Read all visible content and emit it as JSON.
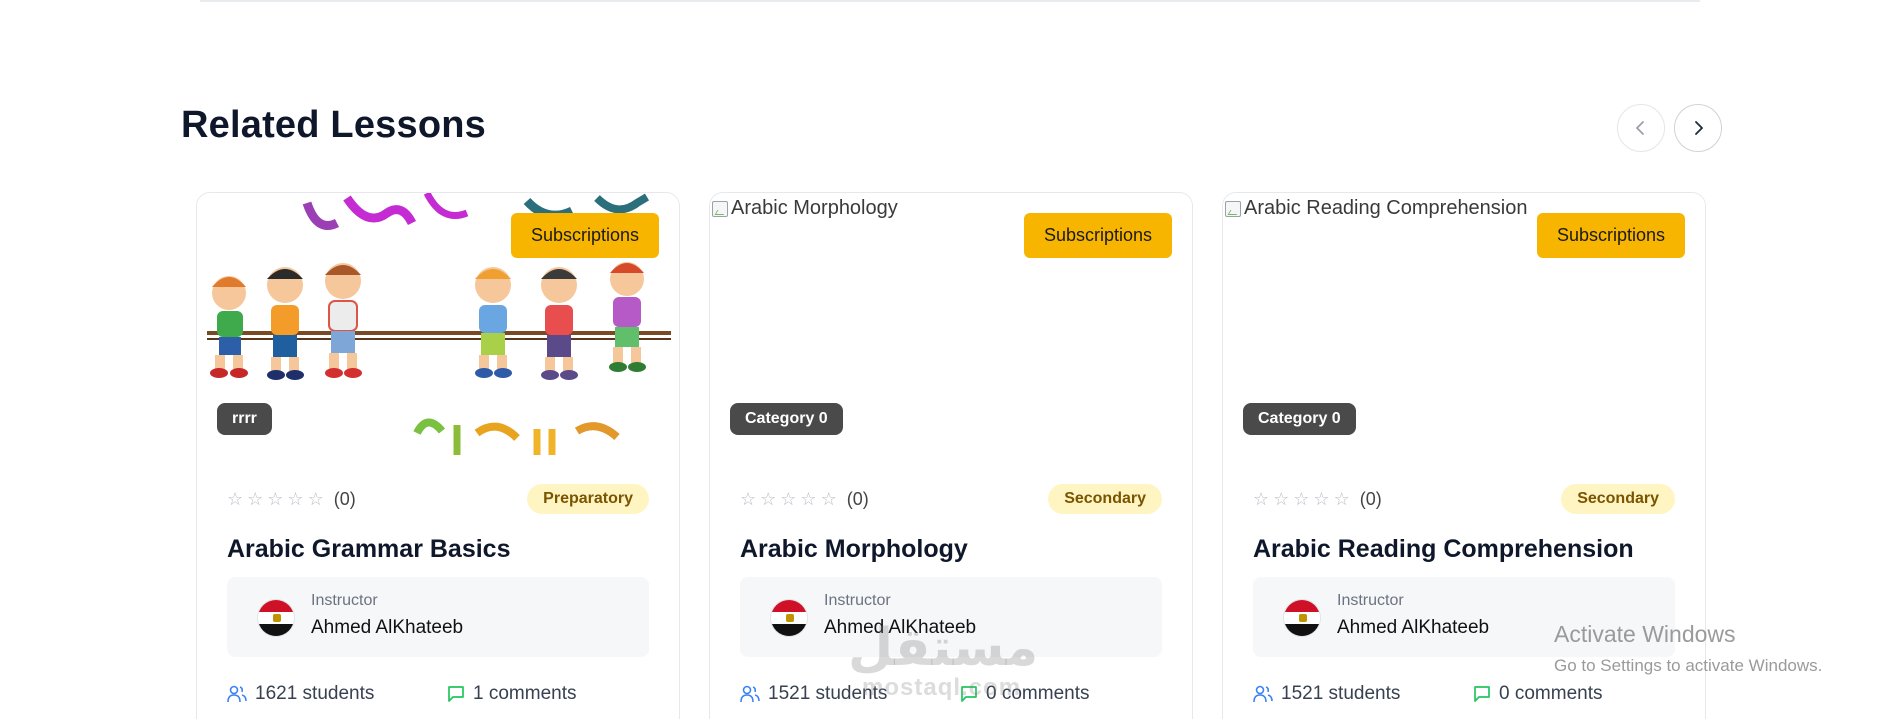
{
  "section": {
    "title": "Related Lessons"
  },
  "carousel": {
    "prev_icon": "chevron-left-icon",
    "next_icon": "chevron-right-icon"
  },
  "cards": [
    {
      "image_alt": "",
      "type_badge": "Subscriptions",
      "category_badge": "rrrr",
      "rating_count": "(0)",
      "level": "Preparatory",
      "title": "Arabic Grammar Basics",
      "instructor_label": "Instructor",
      "instructor_name": "Ahmed AlKhateeb",
      "students": "1621 students",
      "comments": "1 comments"
    },
    {
      "image_alt": "Arabic Morphology",
      "type_badge": "Subscriptions",
      "category_badge": "Category 0",
      "rating_count": "(0)",
      "level": "Secondary",
      "title": "Arabic Morphology",
      "instructor_label": "Instructor",
      "instructor_name": "Ahmed AlKhateeb",
      "students": "1521 students",
      "comments": "0 comments"
    },
    {
      "image_alt": "Arabic Reading Comprehension",
      "type_badge": "Subscriptions",
      "category_badge": "Category 0",
      "rating_count": "(0)",
      "level": "Secondary",
      "title": "Arabic Reading Comprehension",
      "instructor_label": "Instructor",
      "instructor_name": "Ahmed AlKhateeb",
      "students": "1521 students",
      "comments": "0 comments"
    }
  ],
  "overlay": {
    "activate_title": "Activate Windows",
    "activate_sub": "Go to Settings to activate Windows.",
    "watermark": "مستقل",
    "watermark_sub": "mostaql.com"
  },
  "colors": {
    "accent_yellow": "#f7b500",
    "level_pill_bg": "#fff5c2",
    "icon_blue": "#3b82f6",
    "icon_green": "#22c55e",
    "category_badge": "#4a4a4a"
  }
}
